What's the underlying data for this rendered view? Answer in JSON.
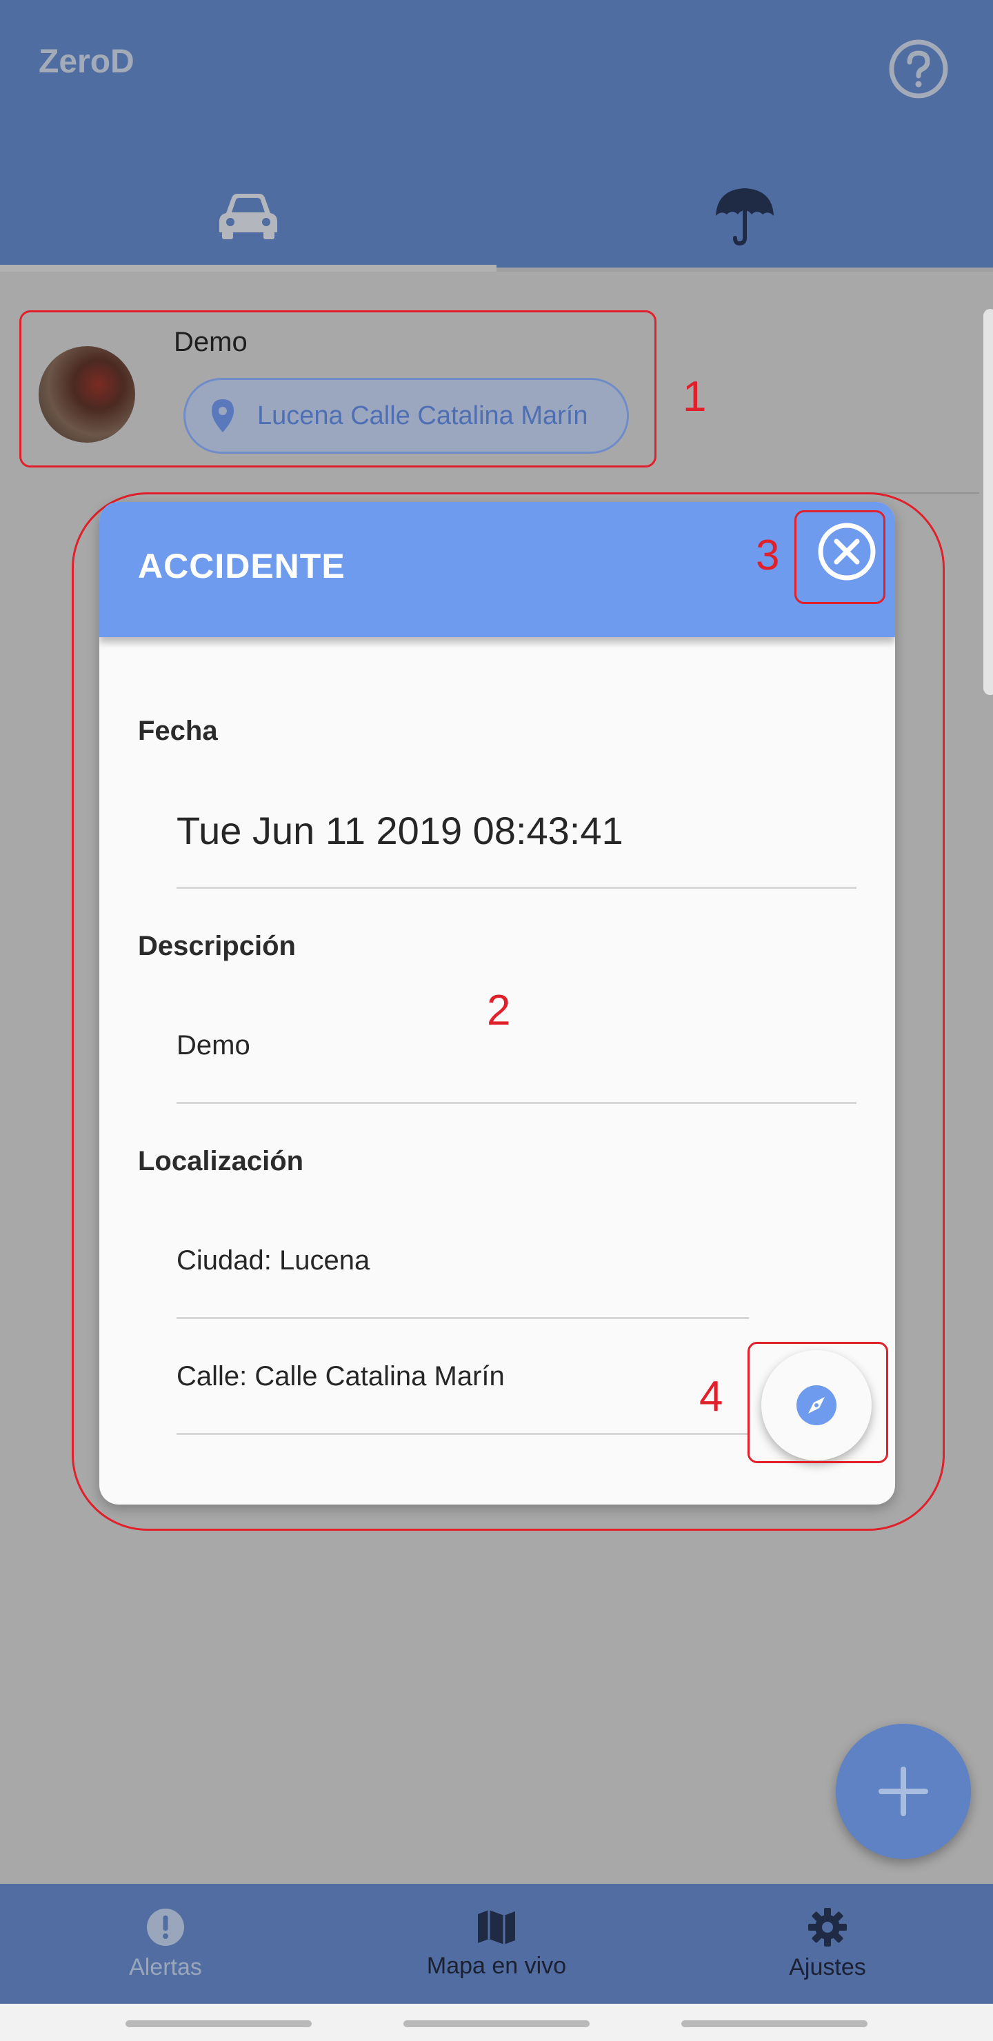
{
  "app": {
    "title": "ZeroD",
    "colors": {
      "primary": "#506da1",
      "dialog_header": "#6e9bed",
      "accent": "#6f8cc9",
      "annotation": "#e0202a"
    }
  },
  "tabs": [
    {
      "icon": "car-icon",
      "active": true
    },
    {
      "icon": "umbrella-icon",
      "active": false
    }
  ],
  "list_item": {
    "name": "Demo",
    "location": "Lucena Calle Catalina Marín"
  },
  "dialog": {
    "title": "ACCIDENTE",
    "fields": {
      "date_label": "Fecha",
      "date_value": "Tue Jun 11 2019 08:43:41",
      "description_label": "Descripción",
      "description_value": "Demo",
      "location_label": "Localización",
      "city_value": "Ciudad: Lucena",
      "street_value": "Calle: Calle Catalina Marín"
    }
  },
  "annotations": [
    "1",
    "2",
    "3",
    "4"
  ],
  "bottom_nav": [
    {
      "label": "Alertas",
      "icon": "alert-icon",
      "active": false
    },
    {
      "label": "Mapa en vivo",
      "icon": "map-icon",
      "active": true
    },
    {
      "label": "Ajustes",
      "icon": "gear-icon",
      "active": true
    }
  ]
}
